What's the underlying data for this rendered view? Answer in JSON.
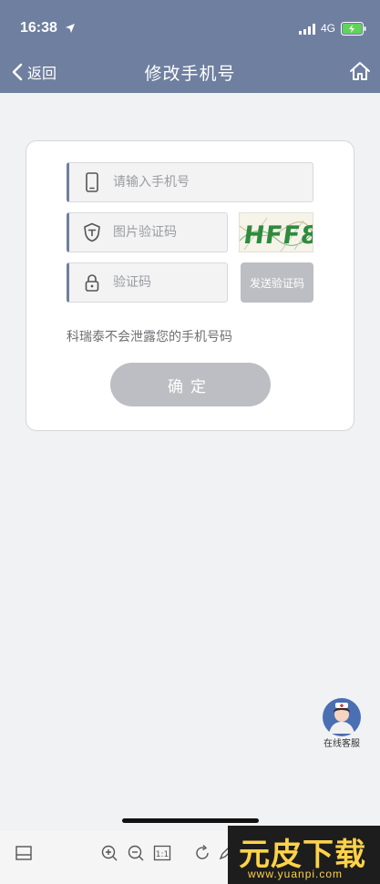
{
  "status_bar": {
    "time": "16:38",
    "network": "4G"
  },
  "nav": {
    "back_label": "返回",
    "title": "修改手机号"
  },
  "form": {
    "phone_placeholder": "请输入手机号",
    "image_code_placeholder": "图片验证码",
    "sms_code_placeholder": "验证码",
    "captcha_text": "HFF8",
    "send_code_label": "发送验证码",
    "privacy_note": "科瑞泰不会泄露您的手机号码",
    "confirm_label": "确定"
  },
  "customer_service": {
    "label": "在线客服"
  },
  "toolbar": {
    "ratio_label": "1:1"
  },
  "watermark": {
    "main": "元皮下载",
    "url": "www.yuanpi.com"
  },
  "colors": {
    "header": "#6f7f9f",
    "button_disabled": "#bdbec3",
    "captcha_text": "#2e8b3e"
  },
  "icons": [
    "location-arrow-icon",
    "signal-icon",
    "battery-charging-icon",
    "chevron-left-icon",
    "home-icon",
    "phone-icon",
    "shield-icon",
    "lock-icon",
    "panel-icon",
    "zoom-in-icon",
    "zoom-out-icon",
    "rotate-icon",
    "pen-icon"
  ]
}
